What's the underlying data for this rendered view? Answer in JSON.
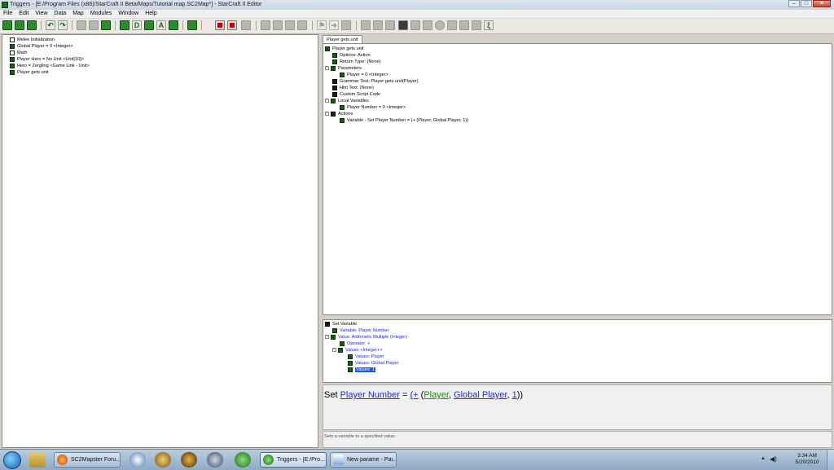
{
  "window": {
    "title": "Triggers - [E:/Program Files (x86)/StarCraft II Beta/Maps/Tutorial map.SC2Map*] - StarCraft II Editor",
    "minimize": "–",
    "maximize": "□",
    "close": "✕"
  },
  "menu": [
    "File",
    "Edit",
    "View",
    "Data",
    "Map",
    "Modules",
    "Window",
    "Help"
  ],
  "toolbar": {
    "icons": [
      "new-trigger-icon",
      "new-folder-icon",
      "save-icon",
      "undo-icon",
      "redo-icon",
      "cut-icon",
      "copy-icon",
      "paste-icon",
      "delete-icon",
      "new-action-icon",
      "new-element-icon",
      "new-variable-icon",
      "text-icon",
      "new-comment-icon",
      "gear-icon",
      "stop-icon",
      "record-icon",
      "page-icon"
    ],
    "glyph_letters": {
      "text": "A",
      "comment": "D"
    }
  },
  "left_tree": [
    {
      "label": "Melee Initialization",
      "icon": "trigger-icon"
    },
    {
      "label": "Global Player = 0 <Integer>",
      "icon": "variable-icon"
    },
    {
      "label": "Math",
      "icon": "trigger-icon"
    },
    {
      "label": "Player Hero = No Unit <Unit[10]>",
      "icon": "variable-icon"
    },
    {
      "label": "Hero = Zergling <Game Link - Unit>",
      "icon": "variable-icon"
    },
    {
      "label": "Player gets unit",
      "icon": "variable-icon"
    }
  ],
  "tab": {
    "label": "Player gets unit"
  },
  "main_tree": {
    "root": "Player gets unit",
    "options": "Options: Action",
    "return_type": "Return Type: (None)",
    "parameters": "Parameters",
    "param_player": "Player = 0 <Integer>",
    "grammar": "Grammar Text: Player gets unit(Player)",
    "hint": "Hint Text: (None)",
    "custom_script": "Custom Script Code",
    "local_variables": "Local Variables",
    "local_player_number": "Player Number = 0 <Integer>",
    "actions": "Actions",
    "action_set": "Variable - Set Player Number = (+ (Player, Global Player, 1))"
  },
  "sub_tree": {
    "root": "Set Variable",
    "variable": "Variable: Player Number",
    "value": "Value: Arithmetic Multiple (Integer)",
    "operator": "Operator: +",
    "values": "Values <Integer+>",
    "values_player": "Values: Player",
    "values_global": "Values: Global Player",
    "values_one": "Values: 1"
  },
  "expression": {
    "prefix": "Set ",
    "variable": "Player Number",
    "eq": " = ",
    "op": "(+",
    "open": " (",
    "arg1": "Player",
    "comma1": ", ",
    "arg2": "Global Player",
    "comma2": ", ",
    "arg3": "1",
    "close": "))"
  },
  "description": "Sets a variable to a specified value.",
  "taskbar": {
    "tasks": [
      {
        "label": "SC2Mapster Foru..."
      },
      {
        "label": "Triggers - [E:/Pro..."
      },
      {
        "label": "New parame - Pai..."
      }
    ],
    "tray_arrow": "▲",
    "speaker": "◀)",
    "time": "3:34 AM",
    "date": "5/20/2010"
  }
}
